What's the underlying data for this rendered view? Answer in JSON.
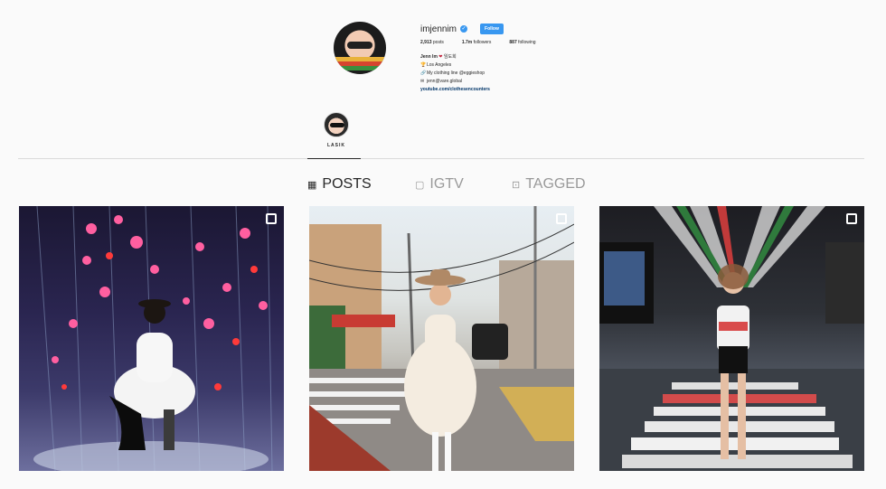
{
  "profile": {
    "username": "imjennim",
    "follow_label": "Follow",
    "stats": {
      "posts_count": "2,913",
      "posts_label": "posts",
      "followers_count": "1.7m",
      "followers_label": "followers",
      "following_count": "887",
      "following_label": "following"
    },
    "bio": {
      "name": "Jenn Im",
      "name_suffix": "임도희",
      "location": "Los Angeles",
      "clothing": "My clothing line @eggieshop",
      "email": "jenn@vare.global",
      "link": "youtube.com/clothesencounters"
    }
  },
  "highlights": [
    {
      "label": "LASIK"
    }
  ],
  "tabs": {
    "posts": "POSTS",
    "igtv": "IGTV",
    "tagged": "TAGGED"
  },
  "colors": {
    "accent": "#3897f0",
    "text": "#262626",
    "muted": "#999999",
    "background": "#fafafa",
    "divider": "#dbdbdb"
  },
  "icons": {
    "verified": "verified-badge-icon",
    "posts_tab": "grid-icon",
    "igtv_tab": "tv-icon",
    "tagged_tab": "tag-icon",
    "multi_post": "carousel-icon"
  }
}
